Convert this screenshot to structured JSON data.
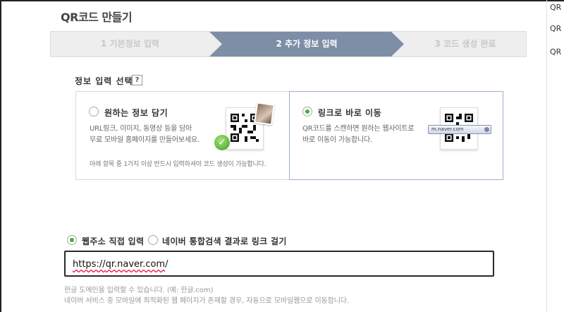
{
  "page": {
    "title": "QR코드 만들기"
  },
  "steps": [
    {
      "label": "1 기본정보 입력",
      "state": "done"
    },
    {
      "label": "2 추가 정보 입력",
      "state": "active"
    },
    {
      "label": "3 코드 생성 완료",
      "state": "pending"
    }
  ],
  "section": {
    "title": "정보 입력 선택",
    "help": "?"
  },
  "options": {
    "info": {
      "title": "원하는 정보 담기",
      "desc_line1": "URL링크, 이미지, 동영상 등을 담아",
      "desc_line2": "무료 모바일 홈페이지를 만들어보세요.",
      "note": "아래 항목 중 1가지 이상 반드시 입력하셔야 코드 생성이 가능합니다.",
      "selected": false
    },
    "link": {
      "title": "링크로 바로 이동",
      "desc_line1": "QR코드를 스캔하면 원하는 웹사이트로",
      "desc_line2": "바로 이동이 가능합니다.",
      "urlbar_text": "m.naver.com",
      "selected": true
    }
  },
  "url_mode": {
    "direct": {
      "label": "웹주소 직접 입력",
      "selected": true
    },
    "search": {
      "label": "네이버 통합검색 결과로 링크 걸기",
      "selected": false
    }
  },
  "url_input": {
    "value_prefix": "https://",
    "value_domain": "qr.naver.com",
    "value_suffix": "/"
  },
  "hints": {
    "line1": "한글 도메인을 입력할 수 있습니다. (예: 한글.com)",
    "line2": "네이버 서비스 중 모바일에 최적화된 웹 페이지가 존재할 경우, 자동으로 모바일웹으로 이동합니다."
  },
  "sidebar": {
    "items": [
      "QR",
      "QR",
      "QR"
    ]
  },
  "colors": {
    "accent_active_step": "#7d8ea6",
    "radio_on": "#3bb13b",
    "selected_border": "#9db0c9"
  }
}
